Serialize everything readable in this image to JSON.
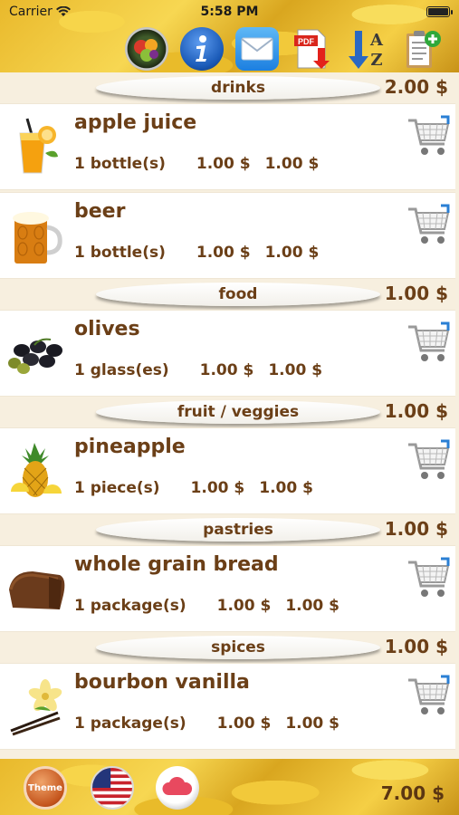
{
  "status": {
    "carrier": "Carrier",
    "time": "5:58 PM"
  },
  "toolbar": {
    "icons": [
      "fruit-icon",
      "info-icon",
      "mail-icon",
      "pdf-export-icon",
      "sort-az-icon",
      "add-list-icon"
    ]
  },
  "categories": [
    {
      "name": "drinks",
      "total": "2.00 $",
      "items": [
        {
          "name": "apple juice",
          "qty": "1 bottle(s)",
          "price": "1.00 $",
          "sum": "1.00 $",
          "icon": "juice-glass-icon"
        },
        {
          "name": "beer",
          "qty": "1 bottle(s)",
          "price": "1.00 $",
          "sum": "1.00 $",
          "icon": "beer-mug-icon"
        }
      ]
    },
    {
      "name": "food",
      "total": "1.00 $",
      "items": [
        {
          "name": "olives",
          "qty": "1 glass(es)",
          "price": "1.00 $",
          "sum": "1.00 $",
          "icon": "olives-icon"
        }
      ]
    },
    {
      "name": "fruit / veggies",
      "total": "1.00 $",
      "items": [
        {
          "name": "pineapple",
          "qty": "1 piece(s)",
          "price": "1.00 $",
          "sum": "1.00 $",
          "icon": "pineapple-icon"
        }
      ]
    },
    {
      "name": "pastries",
      "total": "1.00 $",
      "items": [
        {
          "name": "whole grain bread",
          "qty": "1 package(s)",
          "price": "1.00 $",
          "sum": "1.00 $",
          "icon": "bread-icon"
        }
      ]
    },
    {
      "name": "spices",
      "total": "1.00 $",
      "items": [
        {
          "name": "bourbon vanilla",
          "qty": "1 package(s)",
          "price": "1.00 $",
          "sum": "1.00 $",
          "icon": "vanilla-icon"
        }
      ]
    }
  ],
  "bottom": {
    "theme_label": "Theme",
    "grand_total": "7.00 $"
  },
  "colors": {
    "text_brown": "#6b3f17",
    "banana_yellow": "#f7d54a",
    "info_blue": "#1b5bb8"
  }
}
